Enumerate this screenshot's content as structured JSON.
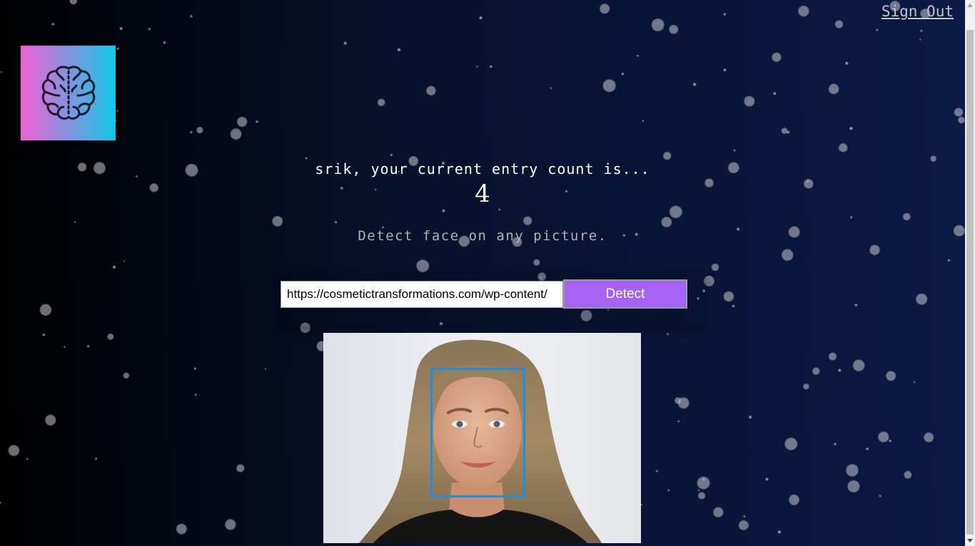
{
  "header": {
    "signout_label": "Sign Out"
  },
  "logo": {
    "icon": "brain-icon",
    "gradient_start": "#f35fd6",
    "gradient_end": "#10c8e6"
  },
  "rank": {
    "greeting": "srik, your current entry count is...",
    "count": "4"
  },
  "form": {
    "subtitle": "Detect face on any picture.",
    "url_value": "https://cosmetictransformations.com/wp-content/",
    "detect_label": "Detect",
    "button_color": "#a463f2"
  },
  "result": {
    "box_color": "#1e8ee0"
  }
}
